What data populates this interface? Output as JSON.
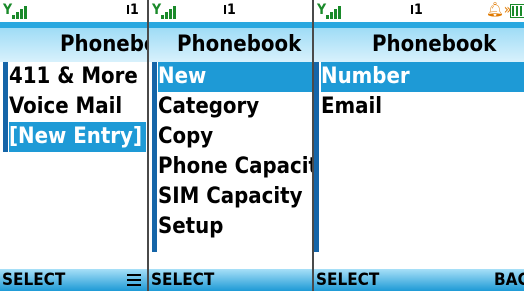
{
  "screens": [
    {
      "status": {
        "line": "1"
      },
      "title": "Phonebook",
      "items": [
        "411 & More",
        "Voice Mail",
        "[New Entry]"
      ],
      "selected_index": 2,
      "softkeys": {
        "left": "SELECT",
        "right_icon": "menu-icon"
      }
    },
    {
      "status": {
        "line": "1"
      },
      "title": "Phonebook",
      "items": [
        "New",
        "Category",
        "Copy",
        "Phone Capacity",
        "SIM Capacity",
        "Setup"
      ],
      "selected_index": 0,
      "softkeys": {
        "left": "SELECT"
      }
    },
    {
      "status": {
        "line": "1",
        "alarm_icon": "alarm-bell-icon",
        "battery_icon": "battery-icon"
      },
      "title": "Phonebook",
      "items": [
        "Number",
        "Email"
      ],
      "selected_index": 0,
      "softkeys": {
        "left": "SELECT",
        "right": "BACK"
      }
    }
  ],
  "colors": {
    "accent": "#1e9ad6",
    "title_bg": "#9fdcf6",
    "status_icons": "#1a8a2a"
  }
}
